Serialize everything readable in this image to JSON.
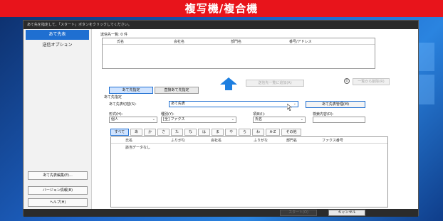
{
  "banner": "複写機/複合機",
  "dialog": {
    "title": "あて先を指定して、「スタート」ボタンをクリックしてください。"
  },
  "sidebar": {
    "items": [
      {
        "label": "あて先表",
        "active": true
      },
      {
        "label": "送信オプション",
        "active": false
      }
    ],
    "bottom_buttons": [
      "あて先表編集(E)...",
      "バージョン情報(B)",
      "ヘルプ(H)"
    ]
  },
  "send_list": {
    "heading": "送信先一覧: 0 件",
    "columns": [
      "氏名",
      "会社名",
      "部門名",
      "番号/アドレス"
    ]
  },
  "actions": {
    "add_to_list": "送信先一覧に追加(A)",
    "delete_list": "一覧から削除(R)",
    "info_symbol": "①"
  },
  "mode_tabs": [
    "あて先指定",
    "直接あて先指定"
  ],
  "dest": {
    "group_label": "あて先指定",
    "switch_label": "あて先表切替(S):",
    "switch_value": "あて先表",
    "manage_button": "あて先表管理(M)",
    "format_label": "形式(H):",
    "format_value": "個人",
    "type_label": "種別(Y):",
    "type_value": "[全] ファクス",
    "item_label": "項目(I):",
    "item_value": "氏名",
    "search_label": "検索内容(D):",
    "search_value": ""
  },
  "kana_tabs": [
    "すべて",
    "あ",
    "か",
    "さ",
    "た",
    "な",
    "は",
    "ま",
    "や",
    "ら",
    "わ",
    "A-Z",
    "その他"
  ],
  "address_table": {
    "columns": [
      "氏名",
      "ふりがな",
      "会社名",
      "ふりがな",
      "部門名",
      "ファクス番号"
    ],
    "empty_text": "該当データなし"
  },
  "footer": {
    "start": "スタート(O)",
    "cancel": "キャンセル"
  },
  "colors": {
    "banner": "#e8141b",
    "accent": "#1f6fd1",
    "arrow": "#1e7fe0"
  }
}
